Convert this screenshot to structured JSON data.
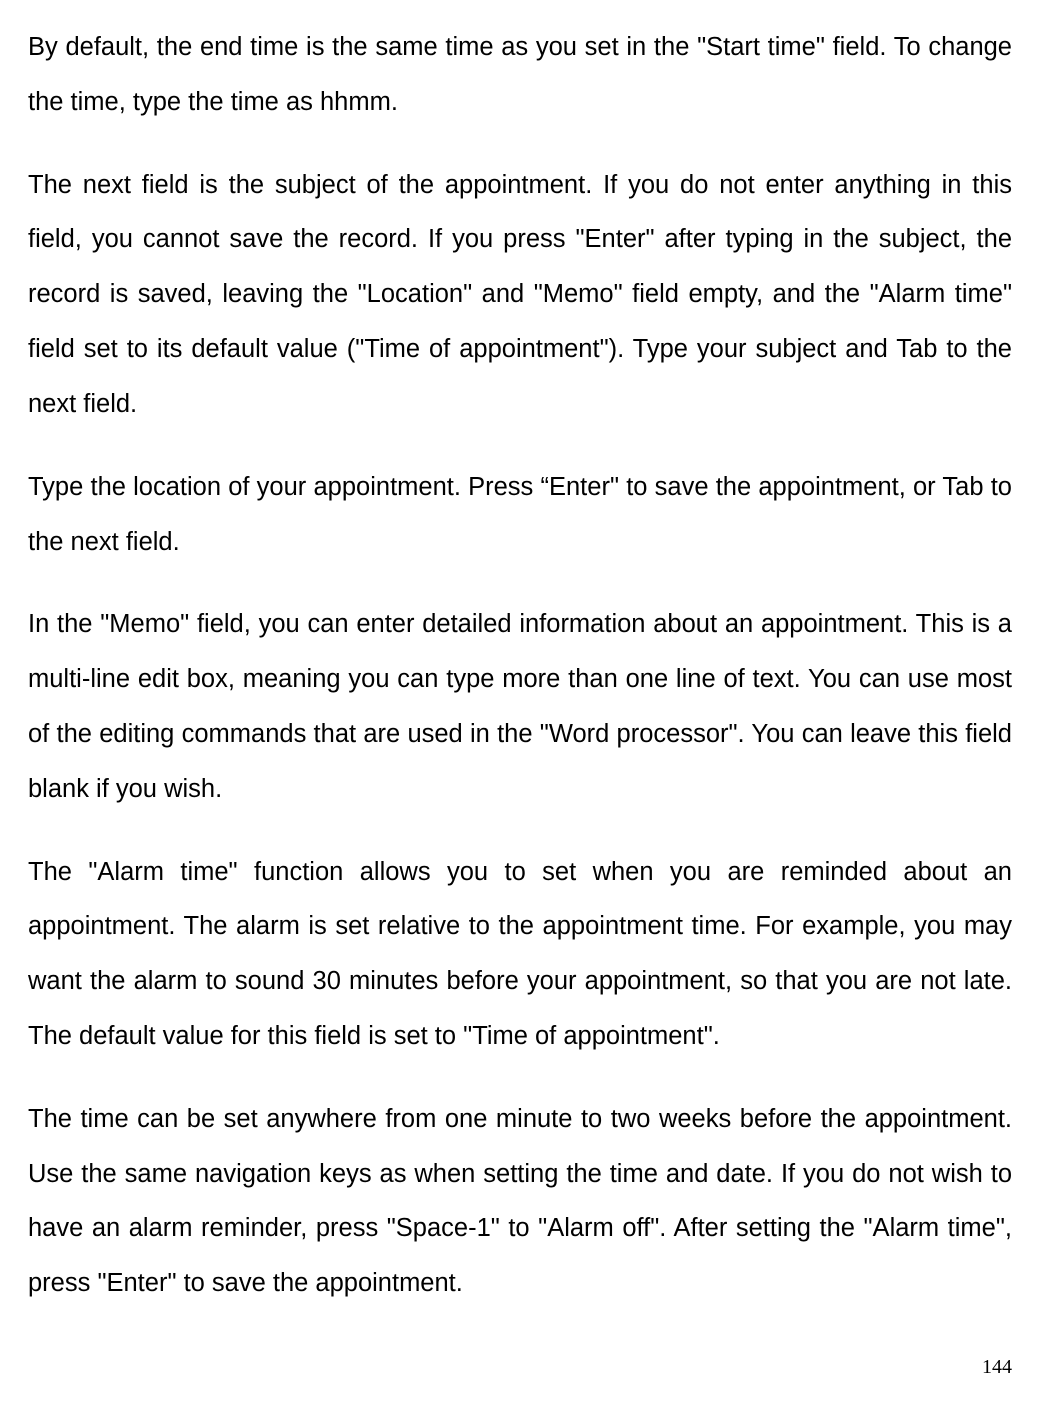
{
  "paragraphs": {
    "p1": "By default, the end time is the same time as you set in the \"Start time\" field. To change the time, type the time as hhmm.",
    "p2": "The next field is the subject of the appointment. If you do not enter anything in this field, you cannot save the record. If you press \"Enter\" after typing in the subject, the record is saved, leaving the \"Location\" and \"Memo\" field empty, and the \"Alarm time\" field set to its default value (\"Time of appointment\"). Type your subject and Tab to the next field.",
    "p3": "Type the location of your appointment. Press “Enter\" to save the appointment, or Tab to the next field.",
    "p4": "In the \"Memo\" field, you can enter detailed information about an appointment. This is a multi-line edit box, meaning you can type more than one line of text. You can use most of the editing commands that are used in the \"Word processor\". You can leave this field blank if you wish.",
    "p5": "The \"Alarm time\" function allows you to set when you are reminded about an appointment. The alarm is set relative to the appointment time. For example, you may want the alarm to sound 30 minutes before your appointment, so that you are not late. The default value for this field is set to \"Time of appointment\".",
    "p6": "The time can be set anywhere from one minute to two weeks before the appointment. Use the same navigation keys as when setting the time and date. If you do not wish to have an alarm reminder, press \"Space-1\" to \"Alarm off\". After setting the \"Alarm time\", press \"Enter\" to save the appointment."
  },
  "page_number": "144"
}
